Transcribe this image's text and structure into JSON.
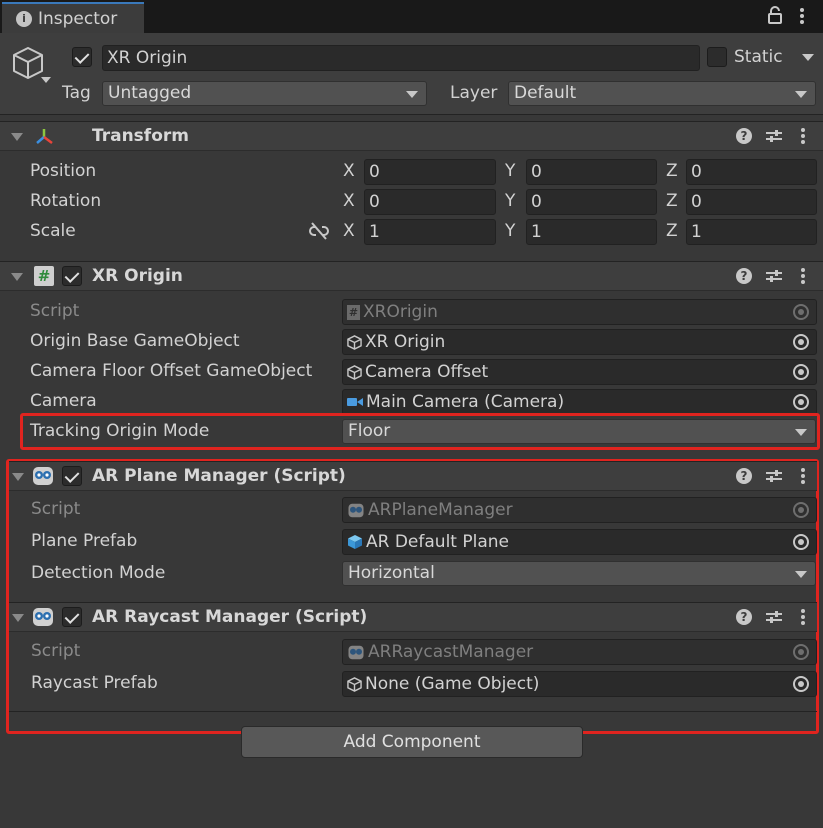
{
  "tab": {
    "title": "Inspector"
  },
  "header": {
    "object_name": "XR Origin",
    "static_label": "Static",
    "tag_label": "Tag",
    "tag_value": "Untagged",
    "layer_label": "Layer",
    "layer_value": "Default"
  },
  "transform": {
    "title": "Transform",
    "rows": [
      {
        "label": "Position",
        "x": "0",
        "y": "0",
        "z": "0"
      },
      {
        "label": "Rotation",
        "x": "0",
        "y": "0",
        "z": "0"
      },
      {
        "label": "Scale",
        "x": "1",
        "y": "1",
        "z": "1"
      }
    ],
    "axis": {
      "x": "X",
      "y": "Y",
      "z": "Z"
    }
  },
  "xr_origin": {
    "title": "XR Origin",
    "script_label": "Script",
    "script_value": "XROrigin",
    "base_label": "Origin Base GameObject",
    "base_value": "XR Origin",
    "offset_label": "Camera Floor Offset GameObject",
    "offset_value": "Camera Offset",
    "camera_label": "Camera",
    "camera_value": "Main Camera (Camera)",
    "tracking_label": "Tracking Origin Mode",
    "tracking_value": "Floor"
  },
  "ar_plane": {
    "title": "AR Plane Manager (Script)",
    "script_label": "Script",
    "script_value": "ARPlaneManager",
    "prefab_label": "Plane Prefab",
    "prefab_value": "AR Default Plane",
    "detection_label": "Detection Mode",
    "detection_value": "Horizontal"
  },
  "ar_raycast": {
    "title": "AR Raycast Manager (Script)",
    "script_label": "Script",
    "script_value": "ARRaycastManager",
    "prefab_label": "Raycast Prefab",
    "prefab_value": "None (Game Object)"
  },
  "add_component": "Add Component",
  "colors": {
    "highlight": "#e0241f",
    "tab_accent": "#3a79bb"
  }
}
